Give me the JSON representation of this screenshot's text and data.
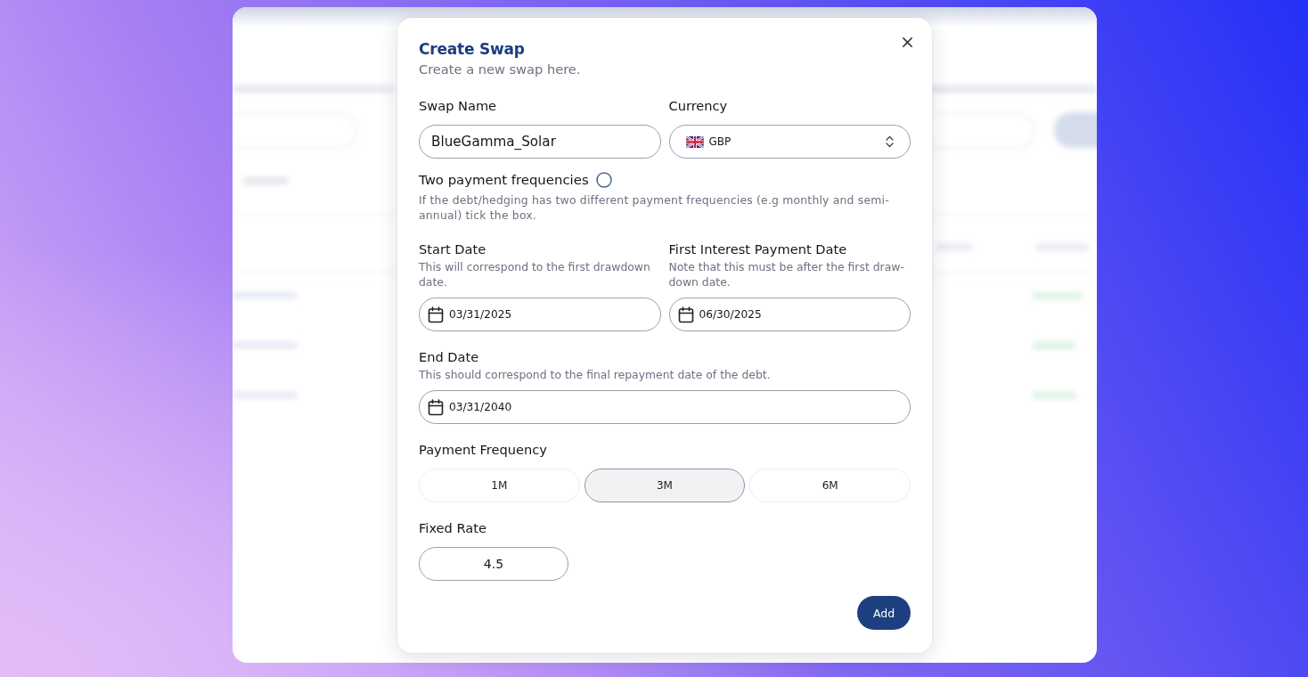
{
  "dialog": {
    "title": "Create Swap",
    "subtitle": "Create a new swap here."
  },
  "swap_name": {
    "label": "Swap Name",
    "value": "BlueGamma_Solar"
  },
  "currency": {
    "label": "Currency",
    "value": "GBP"
  },
  "two_payment_frequencies": {
    "label": "Two payment frequencies",
    "checked": false,
    "help": "If the debt/hedging has two different payment frequencies (e.g monthly and semi-annual) tick the box."
  },
  "start_date": {
    "label": "Start Date",
    "help": "This will correspond to the first drawdown date.",
    "value": "03/31/2025"
  },
  "first_interest_payment_date": {
    "label": "First Interest Payment Date",
    "help": "Note that this must be after the first draw-down date.",
    "value": "06/30/2025"
  },
  "end_date": {
    "label": "End Date",
    "help": "This should correspond to the final repayment date of the debt.",
    "value": "03/31/2040"
  },
  "payment_frequency": {
    "label": "Payment Frequency",
    "options": [
      {
        "label": "1M",
        "selected": false
      },
      {
        "label": "3M",
        "selected": true
      },
      {
        "label": "6M",
        "selected": false
      }
    ]
  },
  "fixed_rate": {
    "label": "Fixed Rate",
    "value": "4.5"
  },
  "buttons": {
    "add": "Add"
  }
}
